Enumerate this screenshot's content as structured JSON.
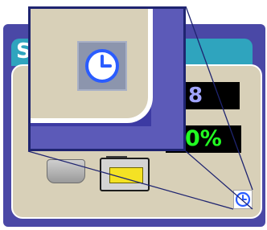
{
  "window": {
    "title": "S"
  },
  "readouts": {
    "top_value": "8",
    "bottom_value": "0%"
  },
  "icons": {
    "clock": "clock-icon",
    "grey_device": "device-icon",
    "yellow_device": "display-icon"
  },
  "colors": {
    "frame": "#4a48a6",
    "title_bar": "#2fa4be",
    "panel": "#d8d0b8",
    "readout_top_text": "#a0a4ff",
    "readout_bottom_text": "#22ff22",
    "clock_blue": "#2a5cff"
  }
}
